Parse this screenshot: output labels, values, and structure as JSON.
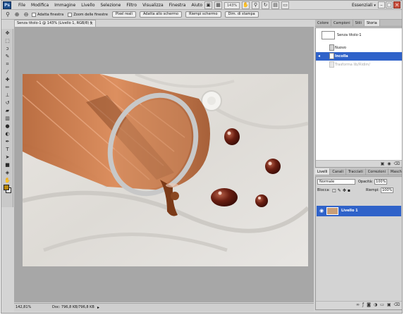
{
  "app": {
    "logo": "Ps"
  },
  "menubar": {
    "items": [
      "File",
      "Modifica",
      "Immagine",
      "Livello",
      "Selezione",
      "Filtro",
      "Visualizza",
      "Finestra",
      "Aiuto"
    ],
    "zoom": "143%",
    "workspace": "Essenziali"
  },
  "options": {
    "adatta_finestra": "Adatta finestra",
    "zoom_finestre": "Zoom delle finestre",
    "buttons": [
      "Pixel reali",
      "Adatta allo schermo",
      "Riempi schermo",
      "Dim. di stampa"
    ]
  },
  "document": {
    "tab_title": "Senza titolo-1 @ 143% (Livello 1, RGB/8) *"
  },
  "status": {
    "zoom": "142,81%",
    "doc": "Doc: 796,8 KB/796,8 KB"
  },
  "history": {
    "tabs": [
      "Colore",
      "Campioni",
      "Stili",
      "Storia"
    ],
    "active_tab": "Storia",
    "snapshot": "Senza titolo-1",
    "items": [
      "Nuovo",
      "Incolla",
      "Trasforma lib/Ridim/"
    ]
  },
  "layers": {
    "tabs": [
      "Livelli",
      "Canali",
      "Tracciati",
      "Correzioni",
      "Maschere"
    ],
    "blend_mode": "Normale",
    "opacity_label": "Opacità:",
    "opacity": "100%",
    "lock_label": "Blocca:",
    "fill_label": "Riempi:",
    "fill": "100%",
    "layer_name": "Livello 1"
  },
  "colors": {
    "accent": "#2f62c9",
    "foreground": "#b8860b",
    "background": "#ffffff"
  },
  "icons": {
    "tools": [
      "move-icon",
      "marquee-icon",
      "lasso-icon",
      "quick-select-icon",
      "crop-icon",
      "eyedropper-icon",
      "healing-icon",
      "brush-icon",
      "stamp-icon",
      "history-brush-icon",
      "eraser-icon",
      "gradient-icon",
      "blur-icon",
      "dodge-icon",
      "pen-icon",
      "type-icon",
      "path-select-icon",
      "shape-icon",
      "3d-icon",
      "hand-icon",
      "zoom-icon"
    ]
  }
}
